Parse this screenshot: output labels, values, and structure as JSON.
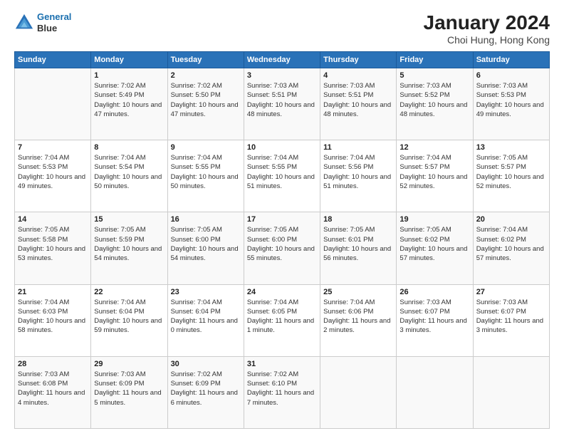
{
  "logo": {
    "line1": "General",
    "line2": "Blue"
  },
  "title": "January 2024",
  "subtitle": "Choi Hung, Hong Kong",
  "header_days": [
    "Sunday",
    "Monday",
    "Tuesday",
    "Wednesday",
    "Thursday",
    "Friday",
    "Saturday"
  ],
  "weeks": [
    [
      {
        "day": "",
        "sunrise": "",
        "sunset": "",
        "daylight": ""
      },
      {
        "day": "1",
        "sunrise": "Sunrise: 7:02 AM",
        "sunset": "Sunset: 5:49 PM",
        "daylight": "Daylight: 10 hours and 47 minutes."
      },
      {
        "day": "2",
        "sunrise": "Sunrise: 7:02 AM",
        "sunset": "Sunset: 5:50 PM",
        "daylight": "Daylight: 10 hours and 47 minutes."
      },
      {
        "day": "3",
        "sunrise": "Sunrise: 7:03 AM",
        "sunset": "Sunset: 5:51 PM",
        "daylight": "Daylight: 10 hours and 48 minutes."
      },
      {
        "day": "4",
        "sunrise": "Sunrise: 7:03 AM",
        "sunset": "Sunset: 5:51 PM",
        "daylight": "Daylight: 10 hours and 48 minutes."
      },
      {
        "day": "5",
        "sunrise": "Sunrise: 7:03 AM",
        "sunset": "Sunset: 5:52 PM",
        "daylight": "Daylight: 10 hours and 48 minutes."
      },
      {
        "day": "6",
        "sunrise": "Sunrise: 7:03 AM",
        "sunset": "Sunset: 5:53 PM",
        "daylight": "Daylight: 10 hours and 49 minutes."
      }
    ],
    [
      {
        "day": "7",
        "sunrise": "Sunrise: 7:04 AM",
        "sunset": "Sunset: 5:53 PM",
        "daylight": "Daylight: 10 hours and 49 minutes."
      },
      {
        "day": "8",
        "sunrise": "Sunrise: 7:04 AM",
        "sunset": "Sunset: 5:54 PM",
        "daylight": "Daylight: 10 hours and 50 minutes."
      },
      {
        "day": "9",
        "sunrise": "Sunrise: 7:04 AM",
        "sunset": "Sunset: 5:55 PM",
        "daylight": "Daylight: 10 hours and 50 minutes."
      },
      {
        "day": "10",
        "sunrise": "Sunrise: 7:04 AM",
        "sunset": "Sunset: 5:55 PM",
        "daylight": "Daylight: 10 hours and 51 minutes."
      },
      {
        "day": "11",
        "sunrise": "Sunrise: 7:04 AM",
        "sunset": "Sunset: 5:56 PM",
        "daylight": "Daylight: 10 hours and 51 minutes."
      },
      {
        "day": "12",
        "sunrise": "Sunrise: 7:04 AM",
        "sunset": "Sunset: 5:57 PM",
        "daylight": "Daylight: 10 hours and 52 minutes."
      },
      {
        "day": "13",
        "sunrise": "Sunrise: 7:05 AM",
        "sunset": "Sunset: 5:57 PM",
        "daylight": "Daylight: 10 hours and 52 minutes."
      }
    ],
    [
      {
        "day": "14",
        "sunrise": "Sunrise: 7:05 AM",
        "sunset": "Sunset: 5:58 PM",
        "daylight": "Daylight: 10 hours and 53 minutes."
      },
      {
        "day": "15",
        "sunrise": "Sunrise: 7:05 AM",
        "sunset": "Sunset: 5:59 PM",
        "daylight": "Daylight: 10 hours and 54 minutes."
      },
      {
        "day": "16",
        "sunrise": "Sunrise: 7:05 AM",
        "sunset": "Sunset: 6:00 PM",
        "daylight": "Daylight: 10 hours and 54 minutes."
      },
      {
        "day": "17",
        "sunrise": "Sunrise: 7:05 AM",
        "sunset": "Sunset: 6:00 PM",
        "daylight": "Daylight: 10 hours and 55 minutes."
      },
      {
        "day": "18",
        "sunrise": "Sunrise: 7:05 AM",
        "sunset": "Sunset: 6:01 PM",
        "daylight": "Daylight: 10 hours and 56 minutes."
      },
      {
        "day": "19",
        "sunrise": "Sunrise: 7:05 AM",
        "sunset": "Sunset: 6:02 PM",
        "daylight": "Daylight: 10 hours and 57 minutes."
      },
      {
        "day": "20",
        "sunrise": "Sunrise: 7:04 AM",
        "sunset": "Sunset: 6:02 PM",
        "daylight": "Daylight: 10 hours and 57 minutes."
      }
    ],
    [
      {
        "day": "21",
        "sunrise": "Sunrise: 7:04 AM",
        "sunset": "Sunset: 6:03 PM",
        "daylight": "Daylight: 10 hours and 58 minutes."
      },
      {
        "day": "22",
        "sunrise": "Sunrise: 7:04 AM",
        "sunset": "Sunset: 6:04 PM",
        "daylight": "Daylight: 10 hours and 59 minutes."
      },
      {
        "day": "23",
        "sunrise": "Sunrise: 7:04 AM",
        "sunset": "Sunset: 6:04 PM",
        "daylight": "Daylight: 11 hours and 0 minutes."
      },
      {
        "day": "24",
        "sunrise": "Sunrise: 7:04 AM",
        "sunset": "Sunset: 6:05 PM",
        "daylight": "Daylight: 11 hours and 1 minute."
      },
      {
        "day": "25",
        "sunrise": "Sunrise: 7:04 AM",
        "sunset": "Sunset: 6:06 PM",
        "daylight": "Daylight: 11 hours and 2 minutes."
      },
      {
        "day": "26",
        "sunrise": "Sunrise: 7:03 AM",
        "sunset": "Sunset: 6:07 PM",
        "daylight": "Daylight: 11 hours and 3 minutes."
      },
      {
        "day": "27",
        "sunrise": "Sunrise: 7:03 AM",
        "sunset": "Sunset: 6:07 PM",
        "daylight": "Daylight: 11 hours and 3 minutes."
      }
    ],
    [
      {
        "day": "28",
        "sunrise": "Sunrise: 7:03 AM",
        "sunset": "Sunset: 6:08 PM",
        "daylight": "Daylight: 11 hours and 4 minutes."
      },
      {
        "day": "29",
        "sunrise": "Sunrise: 7:03 AM",
        "sunset": "Sunset: 6:09 PM",
        "daylight": "Daylight: 11 hours and 5 minutes."
      },
      {
        "day": "30",
        "sunrise": "Sunrise: 7:02 AM",
        "sunset": "Sunset: 6:09 PM",
        "daylight": "Daylight: 11 hours and 6 minutes."
      },
      {
        "day": "31",
        "sunrise": "Sunrise: 7:02 AM",
        "sunset": "Sunset: 6:10 PM",
        "daylight": "Daylight: 11 hours and 7 minutes."
      },
      {
        "day": "",
        "sunrise": "",
        "sunset": "",
        "daylight": ""
      },
      {
        "day": "",
        "sunrise": "",
        "sunset": "",
        "daylight": ""
      },
      {
        "day": "",
        "sunrise": "",
        "sunset": "",
        "daylight": ""
      }
    ]
  ]
}
